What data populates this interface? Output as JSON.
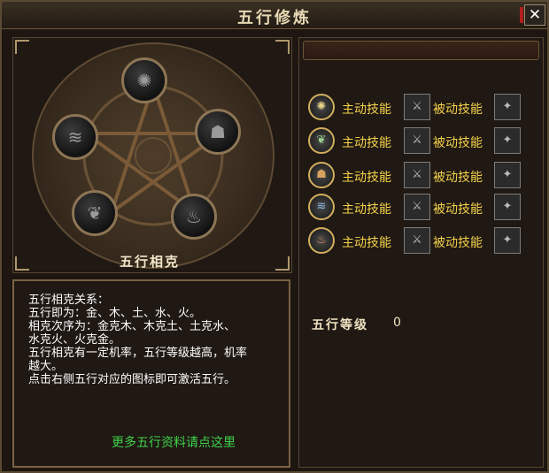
{
  "window": {
    "title": "五行修炼",
    "close_label": "✕"
  },
  "circle": {
    "caption": "五行相克",
    "elements": [
      {
        "name": "metal",
        "glyph": "✺"
      },
      {
        "name": "wood",
        "glyph": "❦"
      },
      {
        "name": "earth",
        "glyph": "☗"
      },
      {
        "name": "water",
        "glyph": "≋"
      },
      {
        "name": "fire",
        "glyph": "♨"
      }
    ]
  },
  "info": {
    "lines": [
      "五行相克关系：",
      "五行即为：金、木、土、水、火。",
      "相克次序为：金克木、木克土、土克水、",
      "水克火、火克金。",
      "五行相克有一定机率，五行等级越高，机率",
      "越大。",
      "点击右侧五行对应的图标即可激活五行。"
    ],
    "more_link": "更多五行资料请点这里"
  },
  "skills": [
    {
      "element": "metal",
      "glyph": "✺",
      "active_label": "主动技能",
      "passive_label": "被动技能"
    },
    {
      "element": "wood",
      "glyph": "❦",
      "active_label": "主动技能",
      "passive_label": "被动技能"
    },
    {
      "element": "earth",
      "glyph": "☗",
      "active_label": "主动技能",
      "passive_label": "被动技能"
    },
    {
      "element": "water",
      "glyph": "≋",
      "active_label": "主动技能",
      "passive_label": "被动技能"
    },
    {
      "element": "fire",
      "glyph": "♨",
      "active_label": "主动技能",
      "passive_label": "被动技能"
    }
  ],
  "level": {
    "label": "五行等级",
    "value": "0"
  },
  "colors": {
    "skill_label": "#f6d34b",
    "link": "#3fd34a",
    "frame": "#7a6343"
  }
}
